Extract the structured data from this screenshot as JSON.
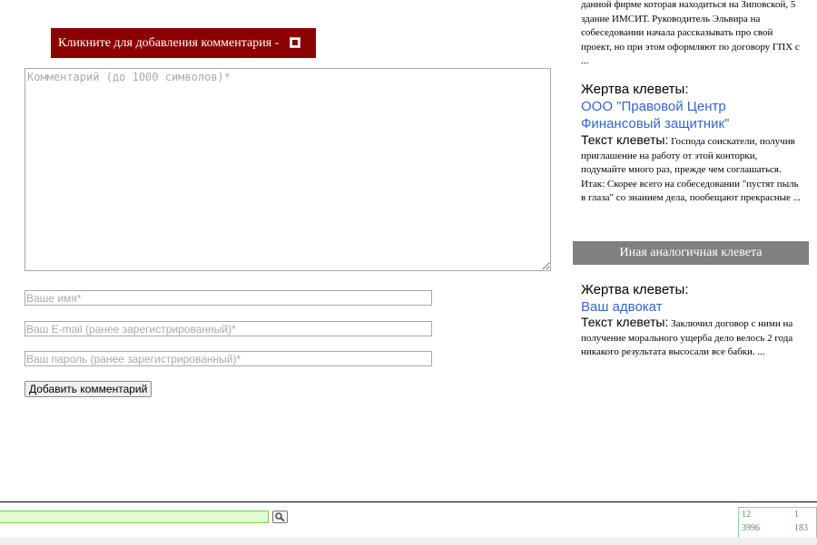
{
  "comment_form": {
    "toggle_label": "Кликните для добавления комментария -",
    "comment_placeholder": "Комментарий (до 1000 символов)*",
    "name_placeholder": "Ваше имя*",
    "email_placeholder": "Ваш E-mail (ранее зарегистрированный)*",
    "password_placeholder": "Ваш пароль (ранее зарегистрированный)*",
    "submit_label": "Добавить комментарий"
  },
  "sidebar": {
    "top_snippet": "данной фирме которая находиться на Зиповской, 5 здание ИМСИТ. Руководитель Эльвира на собеседовании начала рассказывать про свой проект, но при этом оформляют по договору ГПХ с ...",
    "entries": [
      {
        "victim_label": "Жертва клеветы:",
        "victim_name": "ООО \"Правовой Центр Финансовый защитник\"",
        "text_label": "Текст клеветы:",
        "text": "Господа соискатели, получив приглашение на работу от этой конторки, подумайте много раз, прежде чем соглашаться. Итак: Скорее всего на собеседовании \"пустят пыль в глаза\" со знанием дела, пообещают прекрасные ..."
      }
    ],
    "similar_header": "Иная аналогичная клевета",
    "similar_entries": [
      {
        "victim_label": "Жертва клеветы:",
        "victim_name": "Ваш адвокат",
        "text_label": "Текст клеветы:",
        "text": "Заключил договор с ними на получение морального ущерба дело велось 2 года никакого результата высосали все бабки. ..."
      }
    ]
  },
  "footer": {
    "search_icon": "magnifier-icon",
    "counter": {
      "a": "12",
      "b": "1",
      "c": "3996",
      "d": "183"
    }
  },
  "colors": {
    "toggle_bg": "#8b0000",
    "link": "#3366cc",
    "section_header_bg": "#808080",
    "search_bg": "#e0fbd0",
    "counter_text": "#4a9a4a"
  }
}
